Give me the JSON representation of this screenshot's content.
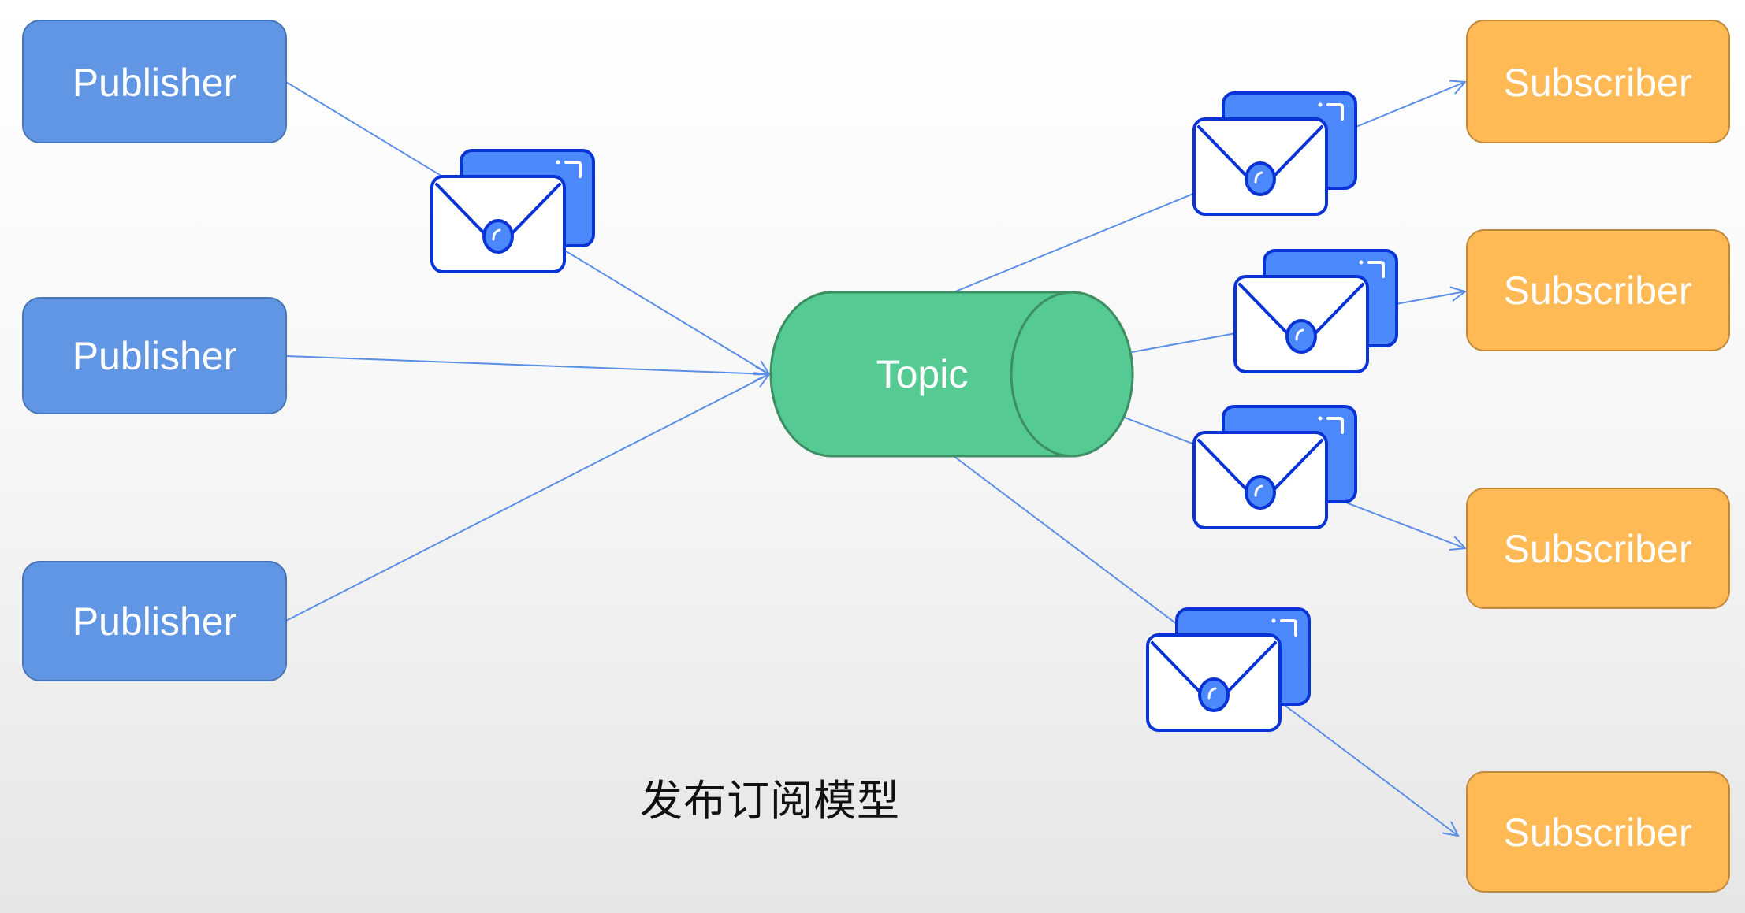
{
  "title": "发布订阅模型",
  "colors": {
    "publisher_fill": "#6096e4",
    "publisher_stroke": "#4a74b3",
    "subscriber_fill": "#ffb955",
    "subscriber_stroke": "#bf8a3e",
    "topic_fill": "#55ca93",
    "topic_stroke": "#3d8f63",
    "edge": "#5b8ee6",
    "envelope_back": "#4b88fb",
    "envelope_stroke": "#0a33d6"
  },
  "topic": {
    "label": "Topic"
  },
  "publishers": [
    {
      "id": "p1",
      "label": "Publisher"
    },
    {
      "id": "p2",
      "label": "Publisher"
    },
    {
      "id": "p3",
      "label": "Publisher"
    }
  ],
  "subscribers": [
    {
      "id": "s1",
      "label": "Subscriber"
    },
    {
      "id": "s2",
      "label": "Subscriber"
    },
    {
      "id": "s3",
      "label": "Subscriber"
    },
    {
      "id": "s4",
      "label": "Subscriber"
    }
  ],
  "edges": [
    {
      "from": "p1",
      "to": "topic",
      "message": true
    },
    {
      "from": "p2",
      "to": "topic",
      "message": false
    },
    {
      "from": "p3",
      "to": "topic",
      "message": false
    },
    {
      "from": "topic",
      "to": "s1",
      "message": true
    },
    {
      "from": "topic",
      "to": "s2",
      "message": true
    },
    {
      "from": "topic",
      "to": "s3",
      "message": true
    },
    {
      "from": "topic",
      "to": "s4",
      "message": true
    }
  ],
  "icons": {
    "message": "envelope-icon"
  }
}
